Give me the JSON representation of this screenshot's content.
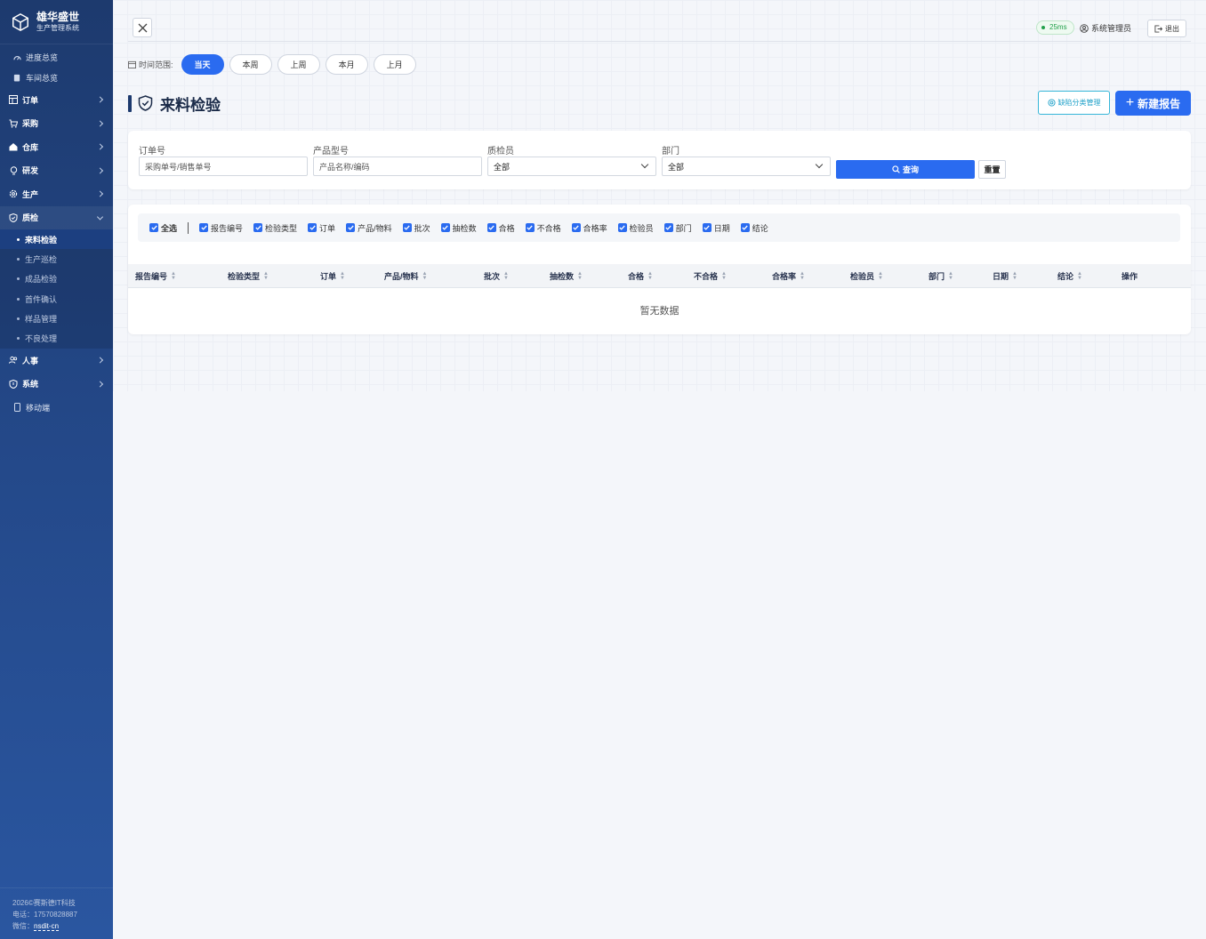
{
  "brand": {
    "title": "雄华盛世",
    "subtitle": "生产管理系统"
  },
  "nav": {
    "top_items": [
      {
        "label": "进度总览",
        "icon": "dashboard-icon"
      },
      {
        "label": "车间总览",
        "icon": "clipboard-icon"
      }
    ],
    "groups": [
      {
        "label": "订单",
        "icon": "table-icon"
      },
      {
        "label": "采购",
        "icon": "cart-icon"
      },
      {
        "label": "仓库",
        "icon": "home-icon"
      },
      {
        "label": "研发",
        "icon": "lightbulb-icon"
      },
      {
        "label": "生产",
        "icon": "gear-icon"
      },
      {
        "label": "质检",
        "icon": "shield-icon"
      }
    ],
    "qc_sub_items": [
      "来料检验",
      "生产巡检",
      "成品检验",
      "首件确认",
      "样品管理",
      "不良处理"
    ],
    "bottom_groups": [
      {
        "label": "人事",
        "icon": "users-icon"
      },
      {
        "label": "系统",
        "icon": "shield-icon"
      }
    ],
    "mobile": {
      "label": "移动端",
      "icon": "mobile-icon"
    }
  },
  "footer": {
    "copyright": "2026©赛斯德IT科技",
    "phone": "电话：17570828887",
    "wechat_label": "微信：",
    "wechat_id": "nsdit-cn"
  },
  "topbar": {
    "latency": "25ms",
    "user": "系统管理员",
    "logout": "退出"
  },
  "time_range": {
    "label": "时间范围:",
    "options": [
      "当天",
      "本周",
      "上周",
      "本月",
      "上月"
    ],
    "selected": "当天"
  },
  "page": {
    "title": "来料检验",
    "defect_button": "缺陷分类管理",
    "new_button": "新建报告"
  },
  "filters": {
    "order": {
      "label": "订单号",
      "placeholder": "采购单号/销售单号"
    },
    "product": {
      "label": "产品型号",
      "placeholder": "产品名称/编码"
    },
    "inspector": {
      "label": "质检员",
      "value": "全部"
    },
    "dept": {
      "label": "部门",
      "value": "全部"
    },
    "search": "查询",
    "reset": "重置"
  },
  "columns_toggle": {
    "select_all": "全选",
    "items": [
      "报告编号",
      "检验类型",
      "订单",
      "产品/物料",
      "批次",
      "抽检数",
      "合格",
      "不合格",
      "合格率",
      "检验员",
      "部门",
      "日期",
      "结论"
    ]
  },
  "table": {
    "headers": [
      "报告编号",
      "检验类型",
      "订单",
      "产品/物料",
      "批次",
      "抽检数",
      "合格",
      "不合格",
      "合格率",
      "检验员",
      "部门",
      "日期",
      "结论",
      "操作"
    ],
    "empty_text": "暂无数据"
  }
}
